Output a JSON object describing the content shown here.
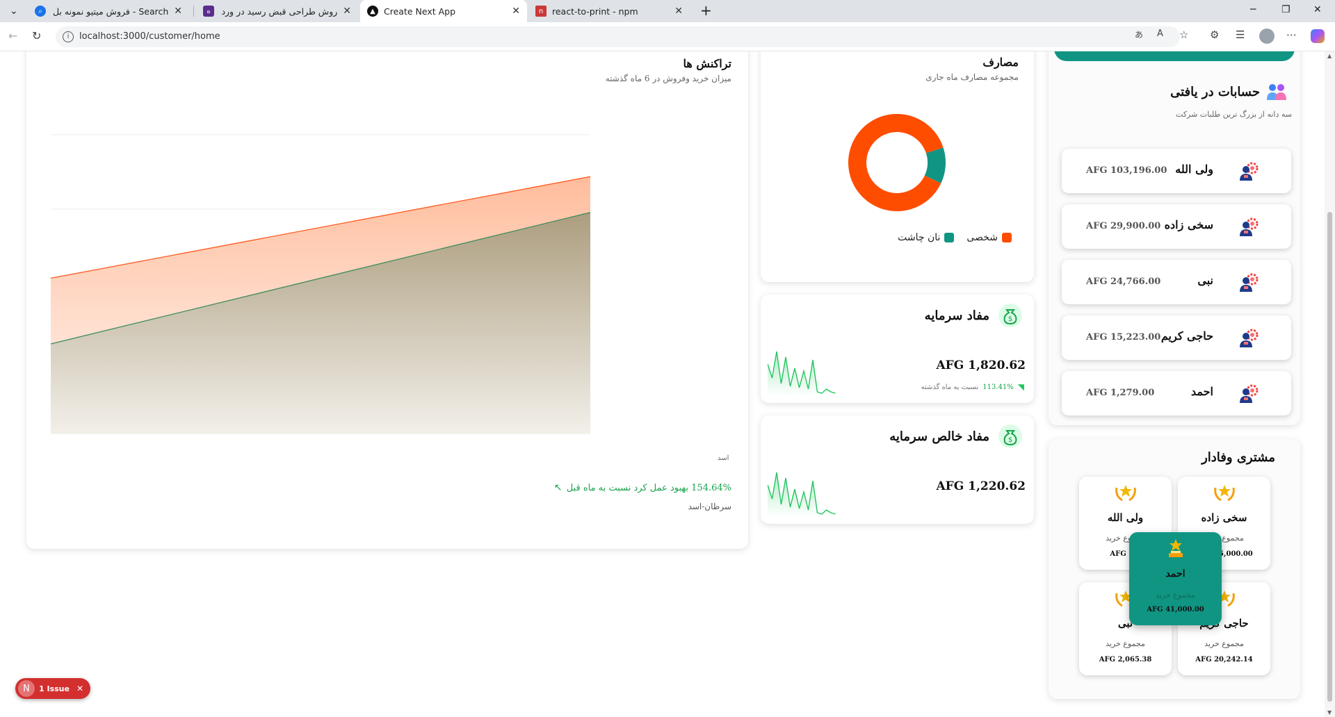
{
  "browser": {
    "tabs": [
      {
        "label": "Search - فروش میتیو نمونه بل رسید"
      },
      {
        "label": "روش طراحی قبض رسید در ورد | دان"
      },
      {
        "label": "Create Next App"
      },
      {
        "label": "react-to-print - npm"
      }
    ],
    "url": "localhost:3000/customer/home",
    "colors": {
      "tab_bar": "#dfe3e8",
      "npm_red": "#cb3837"
    }
  },
  "transactions": {
    "title": "تراکنش ها",
    "subtitle": "میزان خرید وفروش در 6 ماه گذشته",
    "x_tick": "اسد",
    "improvement_text": "154.64% بهبود عمل کرد نسبت به ماه قبل",
    "period": "سرطان-اسد",
    "colors": {
      "sales": "#ff5a1f",
      "purchase": "#3c8c5a",
      "positive": "#16a34a"
    }
  },
  "chart_data": [
    {
      "type": "area",
      "title": "تراکنش ها",
      "subtitle": "میزان خرید وفروش در 6 ماه گذشته",
      "x": [
        "سرطان",
        "اسد"
      ],
      "series": [
        {
          "values": [
            52,
            86
          ]
        },
        {
          "values": [
            30,
            74
          ]
        }
      ],
      "ylim": [
        0,
        100
      ],
      "grid": true
    },
    {
      "type": "pie",
      "title": "مصارف",
      "subtitle": "مجموعه مصارف ماه جاری",
      "categories": [
        "شخصی",
        "نان چاشت"
      ],
      "values": [
        88,
        12
      ],
      "colors": [
        "#ff4d00",
        "#109583"
      ],
      "legend": "bottom"
    }
  ],
  "expenses": {
    "title": "مصارف",
    "subtitle": "مجموعه مصارف ماه جاری",
    "legend": [
      {
        "label": "شخصی",
        "color": "#ff4d00"
      },
      {
        "label": "نان چاشت",
        "color": "#109583"
      }
    ]
  },
  "capital_profit": {
    "title": "مفاد سرمایه",
    "amount": "AFG 1,820.62",
    "change": "113.41%",
    "change_label": "نسبت به ماه گذشته",
    "icon": "money-bag-icon"
  },
  "net_profit": {
    "title": "مفاد خالص سرمایه",
    "amount": "AFG 1,220.62",
    "icon": "money-bag-icon"
  },
  "receivables": {
    "title": "حسابات در یافتی",
    "subtitle": "سه دانه از بزرگ ترین طلبات شرکت",
    "items": [
      {
        "name": "ولی الله",
        "amount": "AFG 103,196.00"
      },
      {
        "name": "سخی زاده",
        "amount": "AFG 29,900.00"
      },
      {
        "name": "نبی",
        "amount": "AFG 24,766.00"
      },
      {
        "name": "حاجی کریم",
        "amount": "AFG 15,223.00"
      },
      {
        "name": "احمد",
        "amount": "AFG 1,279.00"
      }
    ]
  },
  "loyal": {
    "title": "مشتری وفادار",
    "label": "مجموع خرید",
    "cards": [
      {
        "name": "سخی زاده",
        "amount": "AFG 35,000.00"
      },
      {
        "name": "ولی الله",
        "amount": "AFG 25,"
      },
      {
        "name": "حاجی کریم",
        "amount": "AFG 20,242.14"
      },
      {
        "name": "نبی",
        "amount": "AFG 2,065.38"
      }
    ],
    "featured": {
      "name": "احمد",
      "amount": "AFG 41,000.00"
    },
    "colors": {
      "teal": "#109583",
      "gold": "#f2b705"
    }
  },
  "dev_badge": {
    "letter": "N",
    "text": "1 Issue"
  }
}
